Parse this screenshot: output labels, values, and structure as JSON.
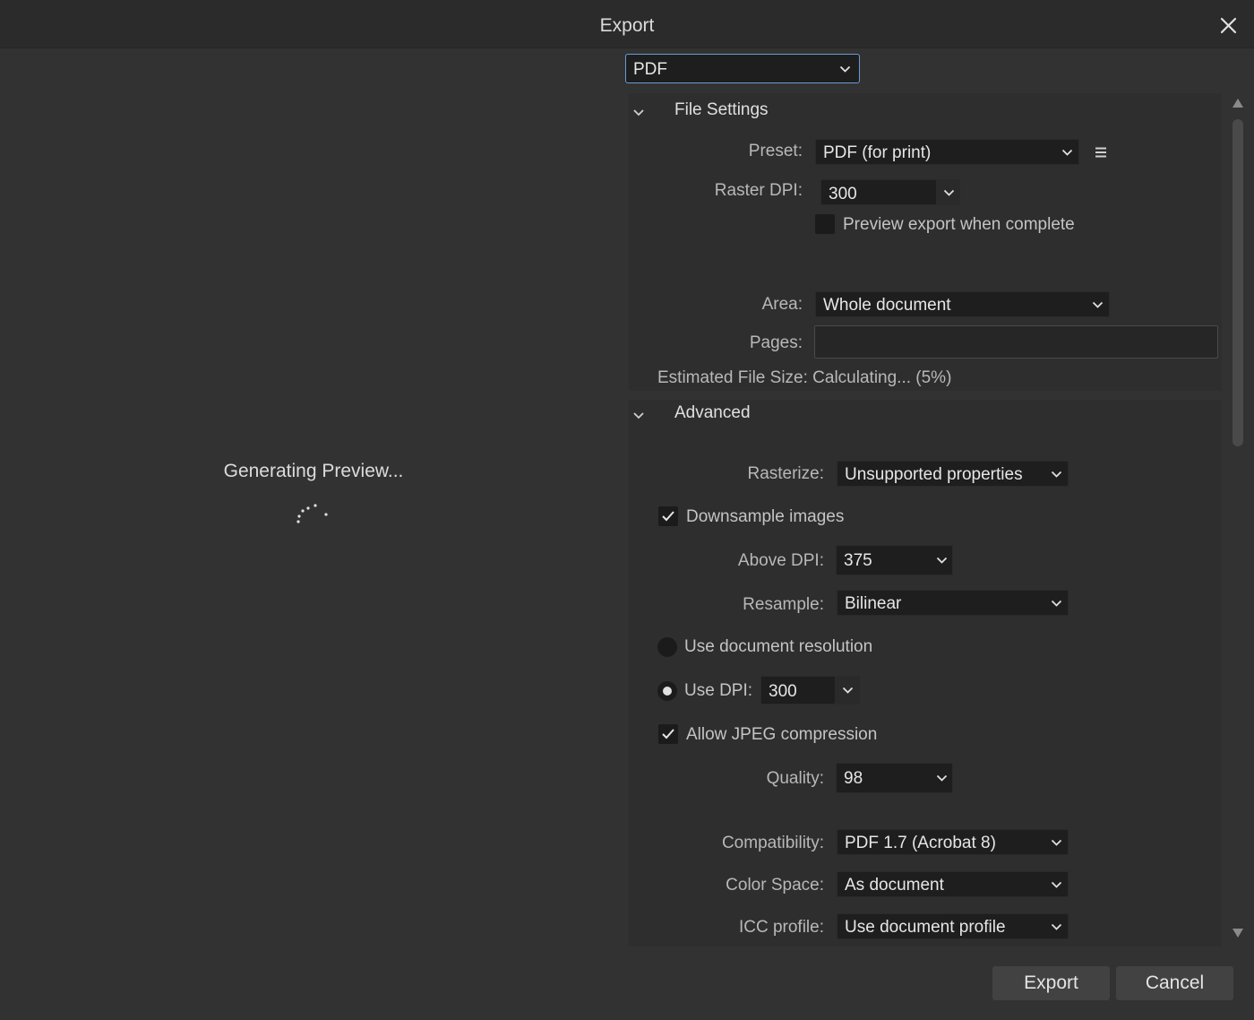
{
  "window": {
    "title": "Export"
  },
  "preview": {
    "status": "Generating Preview..."
  },
  "format": {
    "selected": "PDF"
  },
  "file_settings": {
    "header": "File Settings",
    "preset_label": "Preset:",
    "preset_value": "PDF (for print)",
    "raster_dpi_label": "Raster DPI:",
    "raster_dpi_value": "300",
    "preview_export_label": "Preview export when complete",
    "preview_export_checked": false,
    "area_label": "Area:",
    "area_value": "Whole document",
    "pages_label": "Pages:",
    "pages_value": "",
    "estimated_size": "Estimated File Size: Calculating... (5%)"
  },
  "advanced": {
    "header": "Advanced",
    "rasterize_label": "Rasterize:",
    "rasterize_value": "Unsupported properties",
    "downsample_label": "Downsample images",
    "downsample_checked": true,
    "above_dpi_label": "Above DPI:",
    "above_dpi_value": "375",
    "resample_label": "Resample:",
    "resample_value": "Bilinear",
    "use_doc_res_label": "Use document resolution",
    "use_dpi_label": "Use DPI:",
    "use_dpi_value": "300",
    "allow_jpeg_label": "Allow JPEG compression",
    "allow_jpeg_checked": true,
    "quality_label": "Quality:",
    "quality_value": "98",
    "compat_label": "Compatibility:",
    "compat_value": "PDF 1.7 (Acrobat 8)",
    "color_space_label": "Color Space:",
    "color_space_value": "As document",
    "icc_label": "ICC profile:",
    "icc_value": "Use document profile"
  },
  "buttons": {
    "export": "Export",
    "cancel": "Cancel"
  },
  "colors": {
    "focus_border": "#6a9bd6",
    "background": "#323232",
    "panel": "#2e2e2e"
  }
}
